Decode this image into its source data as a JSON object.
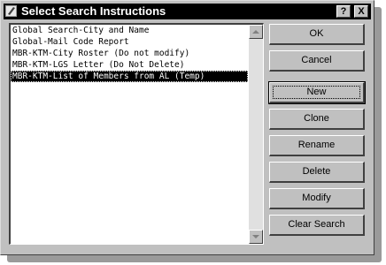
{
  "window": {
    "title": "Select Search Instructions",
    "help_label": "?",
    "close_label": "X"
  },
  "list": {
    "items": [
      {
        "label": "Global Search-City and Name",
        "selected": false
      },
      {
        "label": "Global-Mail Code Report",
        "selected": false
      },
      {
        "label": "MBR-KTM-City Roster (Do not modify)",
        "selected": false
      },
      {
        "label": "MBR-KTM-LGS Letter (Do Not Delete)",
        "selected": false
      },
      {
        "label": "MBR-KTM-List of Members from AL (Temp)",
        "selected": true
      }
    ]
  },
  "buttons": {
    "ok": "OK",
    "cancel": "Cancel",
    "new": "New",
    "clone": "Clone",
    "rename": "Rename",
    "delete": "Delete",
    "modify": "Modify",
    "clear_search": "Clear Search"
  },
  "colors": {
    "face": "#c0c0c0",
    "titlebar": "#000000",
    "selection": "#000000"
  }
}
